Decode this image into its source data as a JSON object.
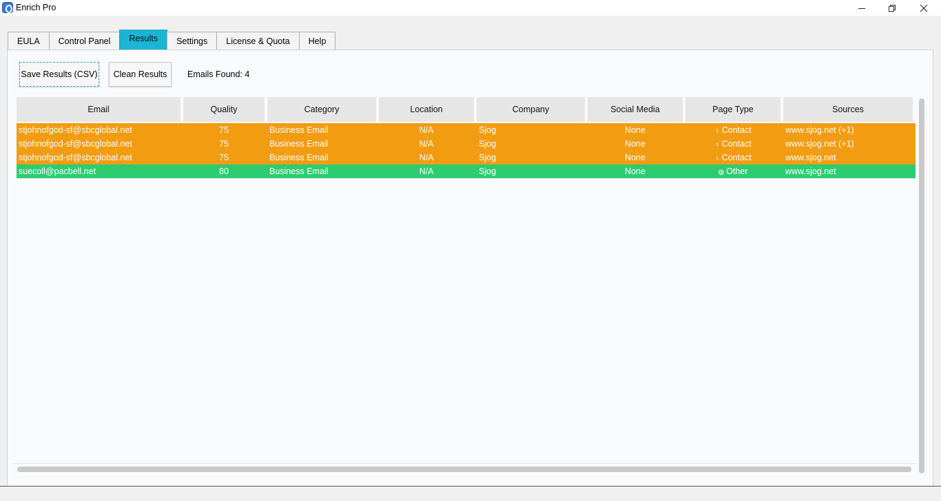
{
  "window": {
    "title": "Enrich Pro",
    "controls": {
      "minimize": "—",
      "maximize": "❐",
      "close": "✕"
    }
  },
  "tabs": [
    {
      "label": "EULA",
      "active": false
    },
    {
      "label": "Control Panel",
      "active": false
    },
    {
      "label": "Results",
      "active": true
    },
    {
      "label": "Settings",
      "active": false
    },
    {
      "label": "License & Quota",
      "active": false
    },
    {
      "label": "Help",
      "active": false
    }
  ],
  "toolbar": {
    "save_label": "Save Results (CSV)",
    "clean_label": "Clean Results",
    "emails_found": "Emails Found: 4"
  },
  "table": {
    "columns": [
      "Email",
      "Quality",
      "Category",
      "Location",
      "Company",
      "Social Media",
      "Page Type",
      "Sources"
    ],
    "rows": [
      {
        "email": "stjohnofgod-sf@sbcglobal.net",
        "quality": "75",
        "category": "Business Email",
        "location": "N/A",
        "company": "Sjog",
        "social": "None",
        "page_type_icon": "♀",
        "page_type": "Contact",
        "sources": "www.sjog.net (+1)",
        "status_color": "#f29c12"
      },
      {
        "email": "stjohnofgod-sf@sbcglobal.net",
        "quality": "75",
        "category": "Business Email",
        "location": "N/A",
        "company": "Sjog",
        "social": "None",
        "page_type_icon": "♀",
        "page_type": "Contact",
        "sources": "www.sjog.net (+1)",
        "status_color": "#f29c12"
      },
      {
        "email": "stjohnofgod-sf@sbcglobal.net",
        "quality": "75",
        "category": "Business Email",
        "location": "N/A",
        "company": "Sjog",
        "social": "None",
        "page_type_icon": "♀",
        "page_type": "Contact",
        "sources": "www.sjog.net",
        "status_color": "#f29c12"
      },
      {
        "email": "suecoll@pacbell.net",
        "quality": "80",
        "category": "Business Email",
        "location": "N/A",
        "company": "Sjog",
        "social": "None",
        "page_type_icon": "◍",
        "page_type": "Other",
        "sources": "www.sjog.net",
        "status_color": "#2ecc71"
      }
    ]
  },
  "colors": {
    "active_tab": "#1ab5d4",
    "row_warning": "#f29c12",
    "row_good": "#2ecc71"
  }
}
